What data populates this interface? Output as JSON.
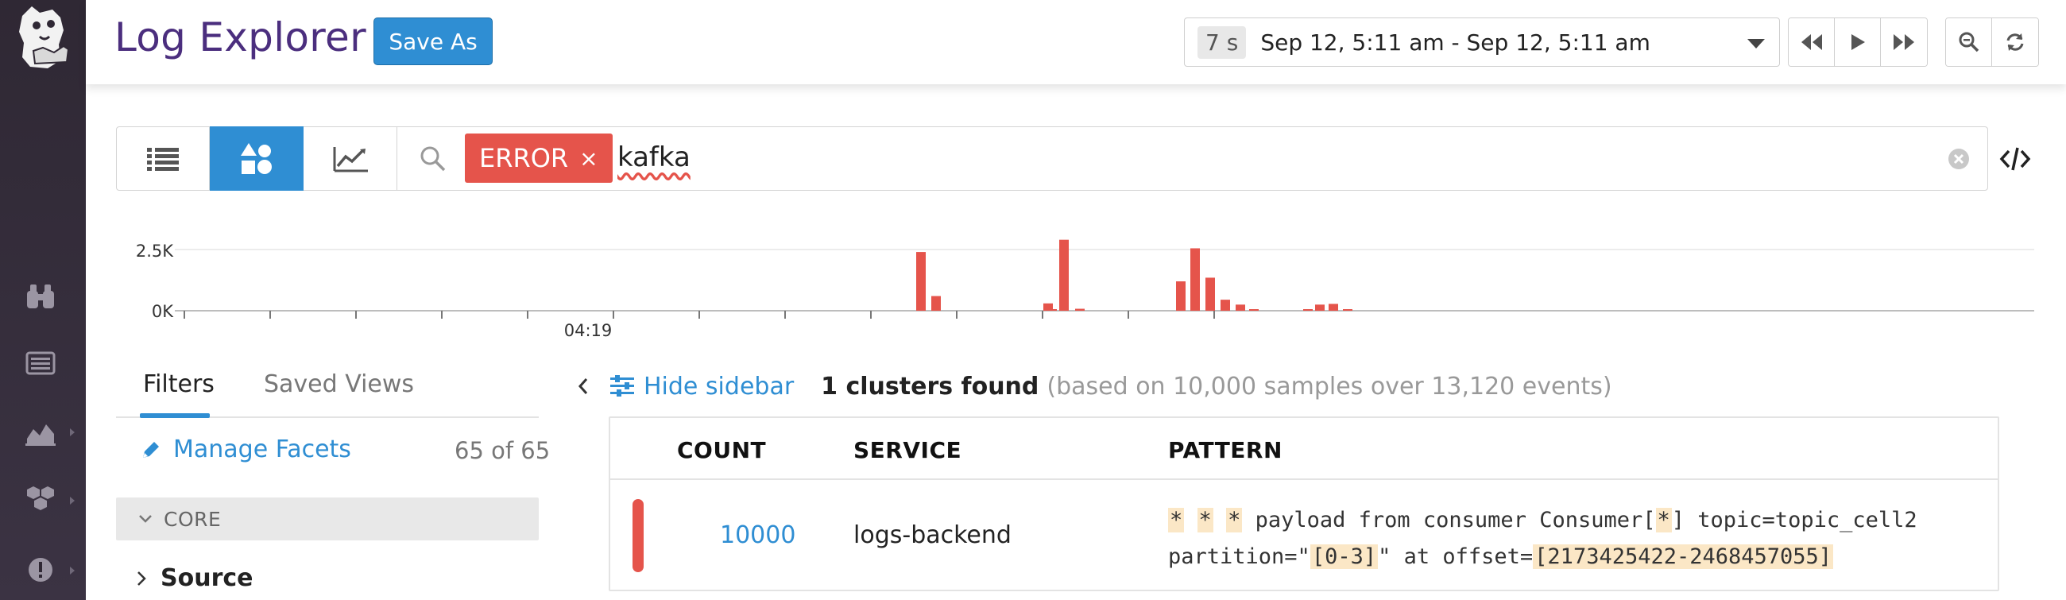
{
  "header": {
    "title": "Log Explorer",
    "save_as_label": "Save As",
    "time_badge": "7 s",
    "time_range": "Sep 12, 5:11 am - Sep 12, 5:11 am"
  },
  "search": {
    "chip_label": "ERROR",
    "chip_remove": "×",
    "query": "kafka"
  },
  "chart_data": {
    "type": "bar",
    "ylabel": "",
    "xlabel": "",
    "y_ticks": [
      "2.5K",
      "0K"
    ],
    "x_tick_label": "04:19",
    "ylim": [
      0,
      3000
    ],
    "grid": true,
    "series": [
      {
        "color": "#e5544b",
        "values": [
          2400,
          600,
          30,
          300,
          2900,
          80,
          1200,
          2550,
          1350,
          450,
          250,
          30,
          50,
          250,
          280,
          40
        ]
      }
    ]
  },
  "sidebar": {
    "tabs": [
      {
        "label": "Filters",
        "active": true
      },
      {
        "label": "Saved Views",
        "active": false
      }
    ],
    "manage_facets": "Manage Facets",
    "facet_count": "65 of 65",
    "core_label": "CORE",
    "source_label": "Source"
  },
  "main": {
    "hide_sidebar": "Hide sidebar",
    "clusters_found": "1 clusters found",
    "clusters_note": "(based on 10,000 samples over 13,120 events)",
    "columns": [
      "COUNT",
      "SERVICE",
      "PATTERN"
    ],
    "rows": [
      {
        "count": "10000",
        "service": "logs-backend",
        "pattern_parts": [
          {
            "text": "*",
            "hl": true
          },
          {
            "text": " ",
            "hl": false
          },
          {
            "text": "*",
            "hl": true
          },
          {
            "text": " ",
            "hl": false
          },
          {
            "text": "*",
            "hl": true
          },
          {
            "text": " payload from consumer Consumer[",
            "hl": false
          },
          {
            "text": "*",
            "hl": true
          },
          {
            "text": "] topic=topic_cell2 partition=\"",
            "hl": false
          },
          {
            "text": "[0-3]",
            "hl": true
          },
          {
            "text": "\" at offset=",
            "hl": false
          },
          {
            "text": "[2173425422-2468457055]",
            "hl": true
          }
        ]
      }
    ]
  },
  "colors": {
    "accent": "#2f8ed3",
    "error": "#e5544b",
    "title": "#4b2e7e",
    "nav_bg": "#2f2834"
  },
  "icons": {
    "nav": [
      "datadog-logo-icon",
      "binoculars-icon",
      "list-icon",
      "chart-icon",
      "hexagons-icon",
      "alert-icon"
    ]
  }
}
